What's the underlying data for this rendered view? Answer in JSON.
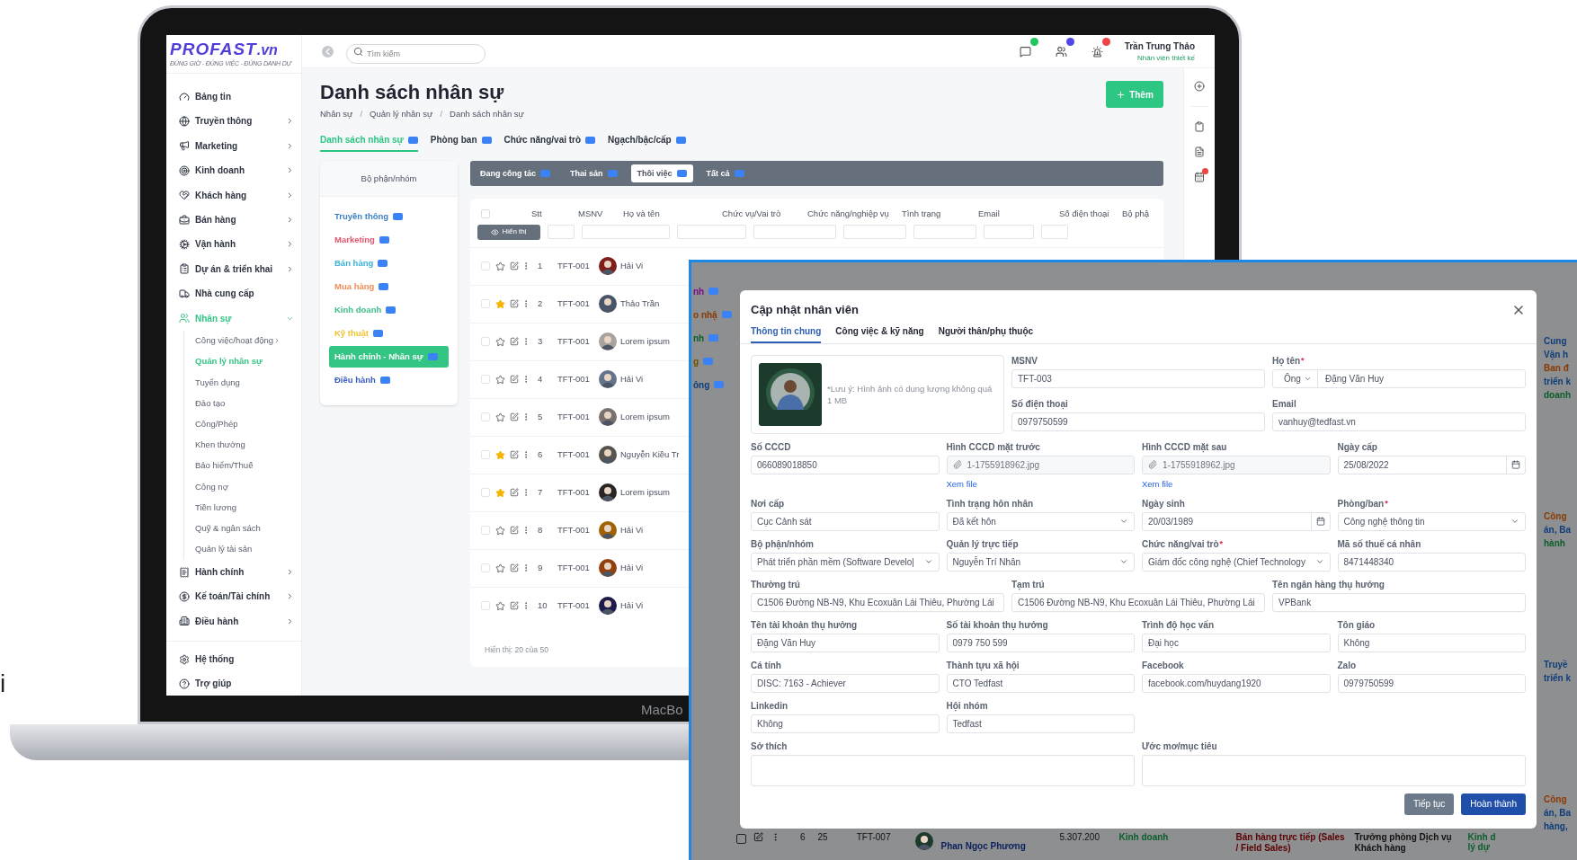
{
  "edge_text": "i",
  "laptop": {
    "bezel_label": "MacBo",
    "logo": {
      "brand": "PROFAST",
      ".vn": ".vn",
      "tagline": "ĐÚNG GIỜ - ĐÚNG VIỆC - ĐÚNG DANH DỰ"
    },
    "sidebar": {
      "items": [
        {
          "label": "Bảng tin",
          "selected": false
        },
        {
          "label": "Truyền thông",
          "selected": false,
          "expanded": false
        },
        {
          "label": "Marketing",
          "selected": false,
          "expanded": false
        },
        {
          "label": "Kinh doanh",
          "selected": false,
          "expanded": false
        },
        {
          "label": "Khách hàng",
          "selected": false,
          "expanded": false
        },
        {
          "label": "Bán hàng",
          "selected": false,
          "expanded": false
        },
        {
          "label": "Vận hành",
          "selected": false,
          "expanded": false
        },
        {
          "label": "Dự án & triển khai",
          "selected": false,
          "expanded": false
        },
        {
          "label": "Nhà cung cấp",
          "selected": false
        },
        {
          "label": "Nhân sự",
          "selected": true,
          "expanded": true,
          "children": [
            {
              "label": "Công việc/hoạt động",
              "selected": false,
              "expanded": false
            },
            {
              "label": "Quản lý nhân sự",
              "selected": true
            },
            {
              "label": "Tuyển dụng",
              "selected": false
            },
            {
              "label": "Đào tạo",
              "selected": false
            },
            {
              "label": "Công/Phép",
              "selected": false
            },
            {
              "label": "Khen thưởng",
              "selected": false
            },
            {
              "label": "Bảo hiểm/Thuế",
              "selected": false
            },
            {
              "label": "Công nợ",
              "selected": false
            },
            {
              "label": "Tiền lương",
              "selected": false
            },
            {
              "label": "Quỹ & ngân sách",
              "selected": false
            },
            {
              "label": "Quản lý tài sản",
              "selected": false
            }
          ]
        },
        {
          "label": "Hành chính",
          "selected": false,
          "expanded": false
        },
        {
          "label": "Kế toán/Tài chính",
          "selected": false,
          "expanded": false
        },
        {
          "label": "Điều hành",
          "selected": false,
          "expanded": false
        }
      ],
      "footer": [
        {
          "label": "Hệ thống"
        },
        {
          "label": "Trợ giúp"
        }
      ]
    },
    "header": {
      "search": {
        "placeholder": "Tìm kiếm"
      },
      "notifications": [
        {
          "color": "#22c55e"
        },
        {
          "color": "#4f46e5"
        },
        {
          "color": "#ef4444"
        }
      ],
      "user": {
        "name": "Trần Trung Thảo",
        "role": "Nhân viên thiết kế"
      }
    },
    "page": {
      "title": "Danh sách nhân sự",
      "breadcrumb": [
        {
          "kind": "link",
          "text": "Nhân sự"
        },
        {
          "kind": "separator",
          "text": "/"
        },
        {
          "kind": "link",
          "text": "Quản lý nhân sự"
        },
        {
          "kind": "separator",
          "text": "/"
        },
        {
          "kind": "link",
          "text": "Danh sách nhân sự"
        }
      ],
      "add_button": "Thêm",
      "tabs": [
        {
          "label": "Danh sách nhân sự",
          "selected": true
        },
        {
          "label": "Phòng ban",
          "selected": false
        },
        {
          "label": "Chức năng/vai trò",
          "selected": false
        },
        {
          "label": "Ngạch/bậc/cấp",
          "selected": false
        }
      ],
      "departments": {
        "title": "Bộ phận/nhóm",
        "items": [
          {
            "label": "Truyền thông",
            "color": "#3b7fc4",
            "selected": false
          },
          {
            "label": "Marketing",
            "color": "#e0566f",
            "selected": false
          },
          {
            "label": "Bán hàng",
            "color": "#38b2d8",
            "selected": false
          },
          {
            "label": "Mua hàng",
            "color": "#f08c5a",
            "selected": false
          },
          {
            "label": "Kinh doanh",
            "color": "#3cc08a",
            "selected": false
          },
          {
            "label": "Kỹ thuật",
            "color": "#f2c230",
            "selected": false
          },
          {
            "label": "Hành chính - Nhân sự",
            "color": "#34c584",
            "selected": true
          },
          {
            "label": "Điều hành",
            "color": "#3b5bc4",
            "selected": false
          }
        ]
      },
      "status_tabs": [
        {
          "label": "Đang công tác",
          "selected": false
        },
        {
          "label": "Thai sản",
          "selected": false
        },
        {
          "label": "Thôi việc",
          "selected": true
        },
        {
          "label": "Tất cả",
          "selected": false
        }
      ],
      "table": {
        "all_checked": false,
        "show_button": "Hiển thị",
        "columns": [
          "Stt",
          "MSNV",
          "Họ và tên",
          "Chức vụ/Vai trò",
          "Chức năng/nghiệp vụ",
          "Tình trạng",
          "Email",
          "Số điện thoại",
          "Bộ phậ"
        ],
        "rows": [
          {
            "checked": false,
            "starred": false,
            "stt": "1",
            "msnv": "TFT-001",
            "name": "Hải Vi"
          },
          {
            "checked": false,
            "starred": true,
            "stt": "2",
            "msnv": "TFT-001",
            "name": "Thảo Trần"
          },
          {
            "checked": false,
            "starred": false,
            "stt": "3",
            "msnv": "TFT-001",
            "name": "Lorem ipsum"
          },
          {
            "checked": false,
            "starred": false,
            "stt": "4",
            "msnv": "TFT-001",
            "name": "Hải Vi"
          },
          {
            "checked": false,
            "starred": false,
            "stt": "5",
            "msnv": "TFT-001",
            "name": "Lorem ipsum"
          },
          {
            "checked": false,
            "starred": true,
            "stt": "6",
            "msnv": "TFT-001",
            "name": "Nguyễn Kiều Tr"
          },
          {
            "checked": false,
            "starred": true,
            "stt": "7",
            "msnv": "TFT-001",
            "name": "Lorem ipsum"
          },
          {
            "checked": false,
            "starred": false,
            "stt": "8",
            "msnv": "TFT-001",
            "name": "Hải Vi"
          },
          {
            "checked": false,
            "starred": false,
            "stt": "9",
            "msnv": "TFT-001",
            "name": "Hải Vi"
          },
          {
            "checked": false,
            "starred": false,
            "stt": "10",
            "msnv": "TFT-001",
            "name": "Hải Vi"
          }
        ],
        "footer": "Hiển thị: 20 của 50"
      }
    }
  },
  "back_window": {
    "left_fragments": [
      {
        "text": "nh",
        "color": "#7a0a8a"
      },
      {
        "text": "o nhậ",
        "color": "#8a3a00"
      },
      {
        "text": "nh",
        "color": "#0b5e2a"
      },
      {
        "text": "g",
        "color": "#6b5200"
      },
      {
        "text": "ông",
        "color": "#0f3d7a"
      }
    ],
    "right_fragments": [
      [
        {
          "text": "Cung",
          "color": "#0f3d7a"
        },
        {
          "text": "Vận h",
          "color": "#0f3d7a"
        },
        {
          "text": "Ban đ",
          "color": "#8a3a00"
        },
        {
          "text": "triển k",
          "color": "#0f3d7a"
        },
        {
          "text": "doanh",
          "color": "#0b5e2a"
        }
      ],
      [
        {
          "text": "Công",
          "color": "#8a3a00"
        },
        {
          "text": "án, Ba",
          "color": "#0f3d7a"
        },
        {
          "text": "hành",
          "color": "#0b5e2a"
        }
      ],
      [
        {
          "text": "Truyề",
          "color": "#0f3d7a"
        },
        {
          "text": "triển k",
          "color": "#0f3d7a"
        }
      ],
      [
        {
          "text": "Công",
          "color": "#8a3a00"
        },
        {
          "text": "án, Ba",
          "color": "#0f3d7a"
        },
        {
          "text": "hàng,",
          "color": "#0f3d7a"
        }
      ]
    ],
    "bottom_row": {
      "checked": false,
      "cells": [
        "6",
        "25",
        "TFT-007"
      ],
      "name": "Phan Ngọc Phương",
      "salary": "5.307.200",
      "department": "Kinh doanh",
      "function": "Bán hàng trực tiếp (Sales / Field Sales)",
      "position": "Trưởng phòng Dịch vụ Khách hàng",
      "last": [
        "Kinh d",
        "lý dự"
      ]
    }
  },
  "dialog": {
    "title": "Cập nhật nhân viên",
    "tabs": [
      {
        "label": "Thông tin chung",
        "selected": true
      },
      {
        "label": "Công việc & kỹ năng",
        "selected": false
      },
      {
        "label": "Người thân/phụ thuộc",
        "selected": false
      }
    ],
    "photo_note": "*Lưu ý: Hình ảnh có dung lượng không quá 1 MB",
    "profile_fields": [
      {
        "kind": "text",
        "label": "MSNV",
        "value": "TFT-003"
      },
      {
        "kind": "name",
        "label": "Họ tên",
        "required_mark": "*",
        "salutation": "Ông",
        "value": "Đặng Văn Huy"
      },
      {
        "kind": "text",
        "label": "Số điện thoại",
        "value": "0979750599"
      },
      {
        "kind": "text",
        "label": "Email",
        "value": "vanhuy@tedfast.vn"
      }
    ],
    "rows": [
      [
        {
          "kind": "text",
          "label": "Số CCCD",
          "value": "066089018850"
        },
        {
          "kind": "file",
          "label": "Hình CCCD mặt trước",
          "value": "1-1755918962.jpg",
          "link": "Xem file"
        },
        {
          "kind": "file",
          "label": "Hình CCCD mặt sau",
          "value": "1-1755918962.jpg",
          "link": "Xem file"
        },
        {
          "kind": "date",
          "label": "Ngày cấp",
          "value": "25/08/2022"
        }
      ],
      [
        {
          "kind": "text",
          "label": "Nơi cấp",
          "value": "Cục Cảnh sát"
        },
        {
          "kind": "select",
          "label": "Tình trạng hôn nhân",
          "value": "Đã kết hôn"
        },
        {
          "kind": "date",
          "label": "Ngày sinh",
          "value": "20/03/1989"
        },
        {
          "kind": "select",
          "label": "Phòng/ban",
          "required_mark": "*",
          "value": "Công nghệ thông tin"
        }
      ],
      [
        {
          "kind": "select",
          "label": "Bộ phận/nhóm",
          "value": "Phát triển phần mềm (Software Develo|"
        },
        {
          "kind": "select",
          "label": "Quản lý trực tiếp",
          "value": "Nguyễn Trí Nhân"
        },
        {
          "kind": "select",
          "label": "Chức năng/vai trò",
          "required_mark": "*",
          "value": "Giám đốc công nghệ (Chief Technology"
        },
        {
          "kind": "text",
          "label": "Mã số thuế cá nhân",
          "value": "8471448340"
        }
      ],
      [
        {
          "kind": "text",
          "label": "Thường trú",
          "value": "C1506 Đường NB-N9, Khu Ecoxuân Lái Thiêu, Phường Lái"
        },
        {
          "kind": "text",
          "label": "Tạm trú",
          "value": "C1506 Đường NB-N9, Khu Ecoxuân Lái Thiêu, Phường Lái"
        },
        {
          "kind": "text",
          "label": "Tên ngân hàng thụ hưởng",
          "value": "VPBank"
        }
      ],
      [
        {
          "kind": "text",
          "label": "Tên tài khoản thụ hưởng",
          "value": "Đặng Văn Huy"
        },
        {
          "kind": "text",
          "label": "Số tài khoản thụ hưởng",
          "value": "0979 750 599"
        },
        {
          "kind": "text",
          "label": "Trình độ học vấn",
          "value": "Đại học"
        },
        {
          "kind": "text",
          "label": "Tôn giáo",
          "value": "Không"
        }
      ],
      [
        {
          "kind": "text",
          "label": "Cá tính",
          "value": "DISC: 7163 - Achiever"
        },
        {
          "kind": "text",
          "label": "Thành tựu xã hội",
          "value": "CTO Tedfast"
        },
        {
          "kind": "text",
          "label": "Facebook",
          "value": "facebook.com/huydang1920"
        },
        {
          "kind": "text",
          "label": "Zalo",
          "value": "0979750599"
        }
      ],
      [
        {
          "kind": "text",
          "label": "Linkedin",
          "value": "Không"
        },
        {
          "kind": "text",
          "label": "Hội nhóm",
          "value": "Tedfast"
        }
      ],
      [
        {
          "kind": "textarea",
          "label": "Sở thích"
        },
        {
          "kind": "textarea",
          "label": "Ước mơ/mục tiêu"
        }
      ]
    ],
    "buttons": [
      {
        "label": "Tiếp tục",
        "kind": "secondary"
      },
      {
        "label": "Hoàn thành",
        "kind": "primary"
      }
    ]
  }
}
